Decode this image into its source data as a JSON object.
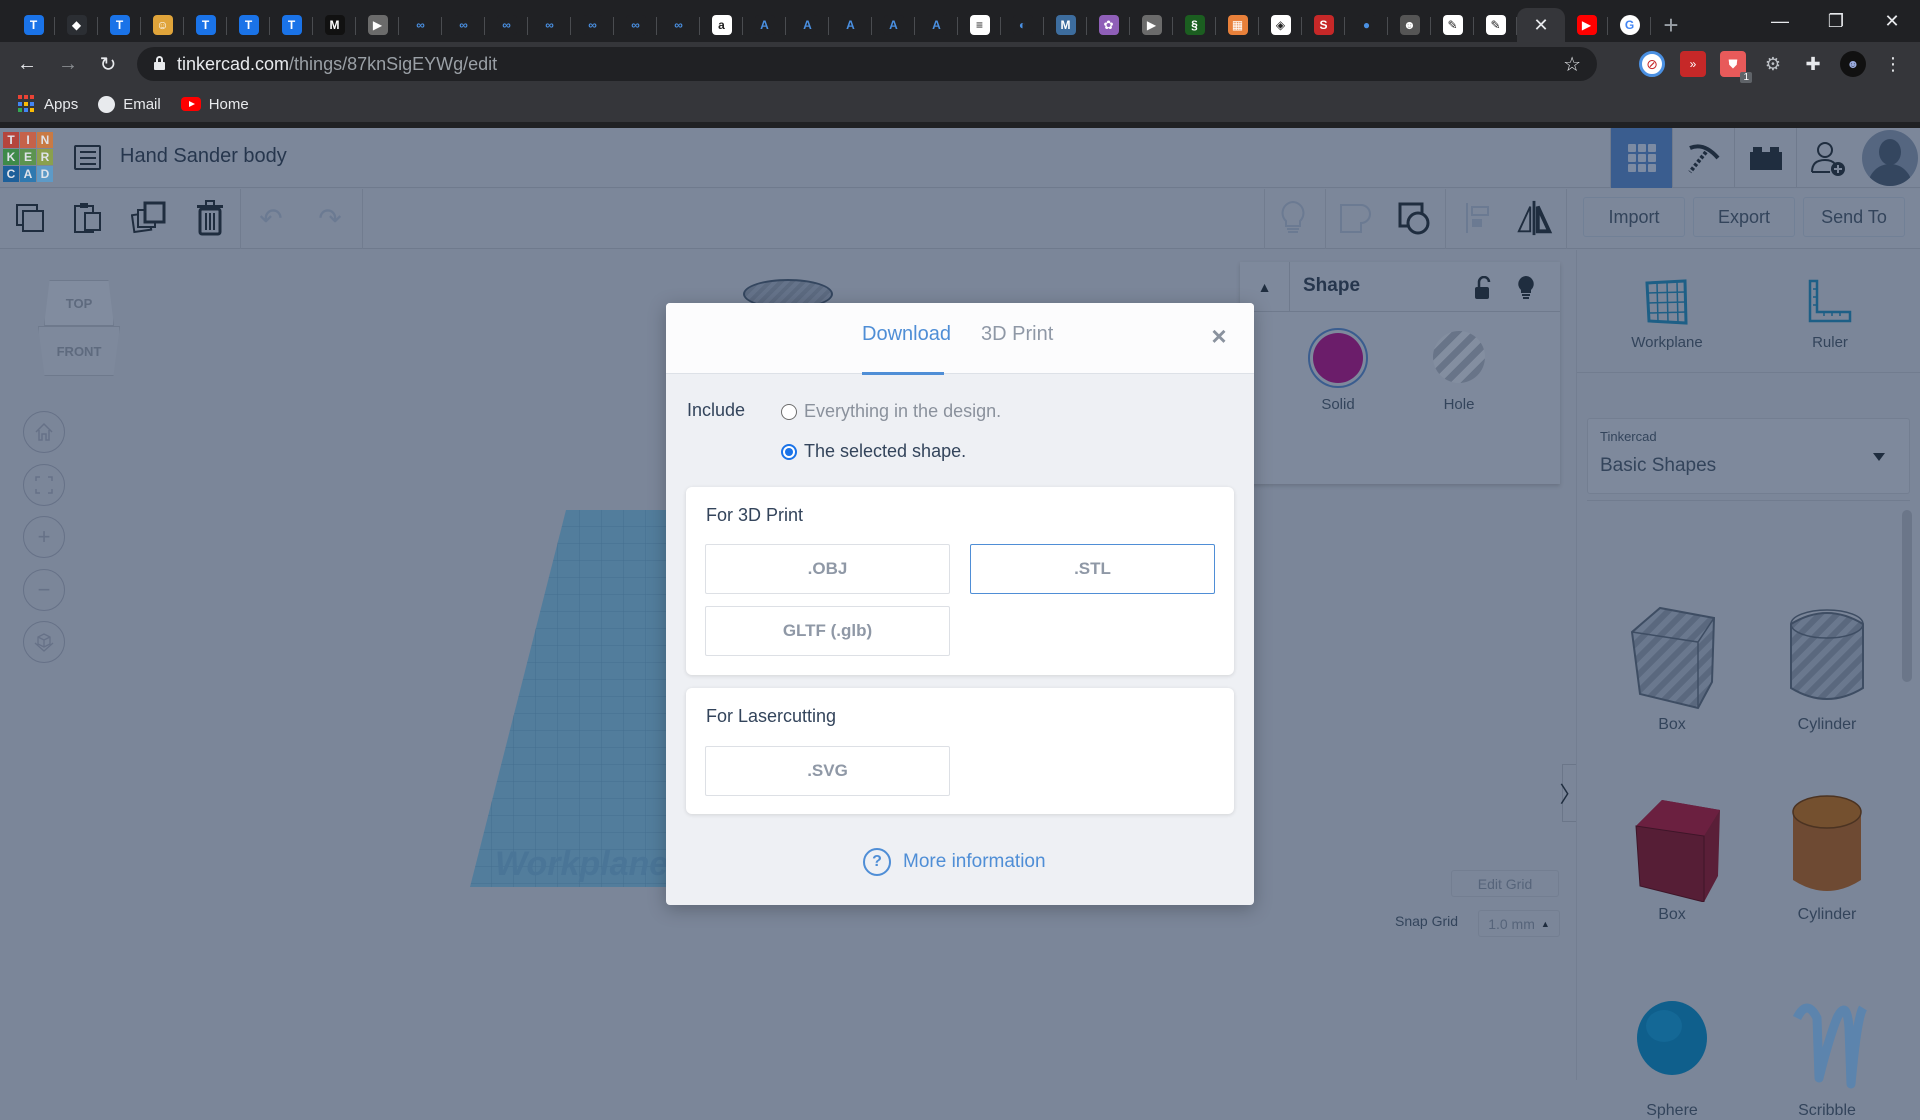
{
  "browser": {
    "tabs": [
      {
        "icon": "tinkercad-tutorial-favicon",
        "glyph": "T",
        "color": "#1a73e8"
      },
      {
        "icon": "cube-logo-favicon",
        "glyph": "◆",
        "color": "#2b2e33"
      },
      {
        "icon": "tinkercad-tutorial-favicon",
        "glyph": "T",
        "color": "#1a73e8"
      },
      {
        "icon": "character-favicon",
        "glyph": "☺",
        "color": "#e0a43a"
      },
      {
        "icon": "tinkercad-tutorial-favicon",
        "glyph": "T",
        "color": "#1a73e8"
      },
      {
        "icon": "tinkercad-tutorial-favicon",
        "glyph": "T",
        "color": "#1a73e8"
      },
      {
        "icon": "tinkercad-tutorial-favicon",
        "glyph": "T",
        "color": "#1a73e8"
      },
      {
        "icon": "medium-favicon",
        "glyph": "M",
        "color": "#111111"
      },
      {
        "icon": "video-favicon",
        "glyph": "▶",
        "color": "#6b6b6b"
      },
      {
        "icon": "infinity-favicon",
        "glyph": "∞",
        "color": "#202124"
      },
      {
        "icon": "infinity-favicon",
        "glyph": "∞",
        "color": "#202124"
      },
      {
        "icon": "infinity-favicon",
        "glyph": "∞",
        "color": "#202124"
      },
      {
        "icon": "infinity-favicon",
        "glyph": "∞",
        "color": "#202124"
      },
      {
        "icon": "infinity-favicon",
        "glyph": "∞",
        "color": "#202124"
      },
      {
        "icon": "infinity-favicon",
        "glyph": "∞",
        "color": "#202124"
      },
      {
        "icon": "infinity-favicon",
        "glyph": "∞",
        "color": "#202124"
      },
      {
        "icon": "amazon-favicon",
        "glyph": "a",
        "color": "#ffffff"
      },
      {
        "icon": "autodesk-favicon",
        "glyph": "A",
        "color": "#202124"
      },
      {
        "icon": "autodesk-favicon",
        "glyph": "A",
        "color": "#202124"
      },
      {
        "icon": "autodesk-favicon",
        "glyph": "A",
        "color": "#202124"
      },
      {
        "icon": "autodesk-favicon",
        "glyph": "A",
        "color": "#202124"
      },
      {
        "icon": "autodesk-favicon",
        "glyph": "A",
        "color": "#202124"
      },
      {
        "icon": "doc-favicon",
        "glyph": "≡",
        "color": "#ffffff"
      },
      {
        "icon": "globe-favicon",
        "glyph": "◐",
        "color": "#202124"
      },
      {
        "icon": "m-logo-favicon",
        "glyph": "M",
        "color": "#3d6d9e"
      },
      {
        "icon": "colorful-favicon",
        "glyph": "✿",
        "color": "#8f5fb8"
      },
      {
        "icon": "video-favicon",
        "glyph": "▶",
        "color": "#6b6b6b"
      },
      {
        "icon": "green-logo-favicon",
        "glyph": "§",
        "color": "#1b5e20"
      },
      {
        "icon": "tinkercad-favicon",
        "glyph": "▦",
        "color": "#e8803a"
      },
      {
        "icon": "diamond-favicon",
        "glyph": "◈",
        "color": "#ffffff"
      },
      {
        "icon": "red-logo-favicon",
        "glyph": "S",
        "color": "#c62828"
      },
      {
        "icon": "github-favicon",
        "glyph": "●",
        "color": "#202124"
      },
      {
        "icon": "gimp-favicon",
        "glyph": "☻",
        "color": "#555555"
      },
      {
        "icon": "sketch-favicon",
        "glyph": "✎",
        "color": "#ffffff"
      },
      {
        "icon": "sketch-favicon",
        "glyph": "✎",
        "color": "#ffffff"
      }
    ],
    "active_tab_close": "✕",
    "after_active_tabs": [
      {
        "icon": "youtube-favicon",
        "glyph": "▶",
        "color": "#ff0000"
      },
      {
        "icon": "google-favicon",
        "glyph": "G",
        "color": "#ffffff"
      }
    ],
    "new_tab": "+",
    "window": {
      "minimize": "—",
      "restore": "❐",
      "close": "✕"
    },
    "url_host": "tinkercad.com",
    "url_path": "/things/87knSigEYWg/edit",
    "extension_badge": "1",
    "bookmarks": [
      {
        "label": "Apps",
        "icon": "apps-grid-icon"
      },
      {
        "label": "Email",
        "icon": "globe-icon"
      },
      {
        "label": "Home",
        "icon": "youtube-icon"
      }
    ]
  },
  "app": {
    "logo_letters": [
      "T",
      "I",
      "N",
      "K",
      "E",
      "R",
      "C",
      "A",
      "D"
    ],
    "logo_colors": [
      "#b5453d",
      "#c5624a",
      "#c87a45",
      "#3e8a4a",
      "#5c9450",
      "#8aa04e",
      "#1d5f9a",
      "#2f79b0",
      "#5d9ac7"
    ],
    "design_title": "Hand Sander body",
    "toolbar": {
      "import": "Import",
      "export": "Export",
      "send_to": "Send To"
    },
    "viewcube": {
      "top": "TOP",
      "front": "FRONT"
    },
    "workplane_label": "Workplane",
    "shape_panel": {
      "title": "Shape",
      "solid_label": "Solid",
      "hole_label": "Hole",
      "solid_color": "#6b1d6a"
    },
    "right_panel": {
      "workplane_tool": "Workplane",
      "ruler_tool": "Ruler",
      "library_source": "Tinkercad",
      "library_selected": "Basic Shapes",
      "shapes": [
        {
          "label": "Box",
          "kind": "box-hole"
        },
        {
          "label": "Cylinder",
          "kind": "cylinder-hole"
        },
        {
          "label": "Box",
          "kind": "box"
        },
        {
          "label": "Cylinder",
          "kind": "cylinder"
        },
        {
          "label": "Sphere",
          "kind": "sphere"
        },
        {
          "label": "Scribble",
          "kind": "scribble"
        }
      ]
    },
    "edit_grid": "Edit Grid",
    "snap_grid_label": "Snap Grid",
    "snap_grid_value": "1.0 mm",
    "collapse_glyph": "〉"
  },
  "modal": {
    "tabs": [
      {
        "label": "Download",
        "active": true
      },
      {
        "label": "3D Print",
        "active": false
      }
    ],
    "close": "×",
    "include_label": "Include",
    "options": [
      {
        "label": "Everything in the design.",
        "selected": false
      },
      {
        "label": "The selected shape.",
        "selected": true
      }
    ],
    "print_section": {
      "title": "For 3D Print",
      "formats": [
        ".OBJ",
        ".STL",
        "GLTF (.glb)"
      ]
    },
    "laser_section": {
      "title": "For Lasercutting",
      "formats": [
        ".SVG"
      ]
    },
    "more_info": "More information",
    "help_glyph": "?"
  }
}
